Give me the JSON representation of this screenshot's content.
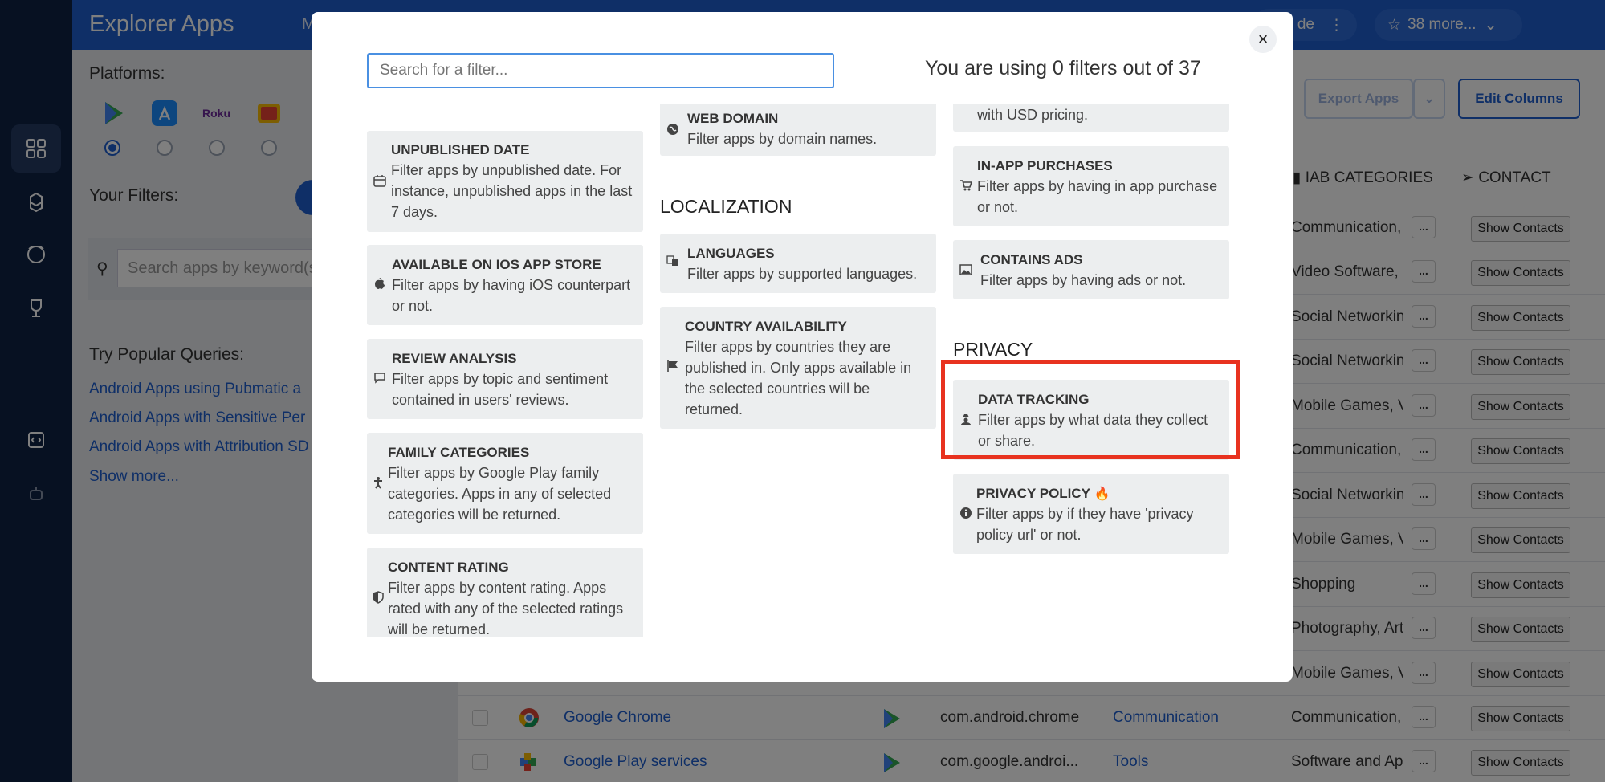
{
  "app_title": "Explorer Apps",
  "top_nav_partial": "M",
  "top_pills": {
    "partial_label": "de",
    "more_label": "38 more..."
  },
  "left_panel": {
    "platforms_label": "Platforms:",
    "roku_label": "Roku",
    "your_filters_label": "Your Filters:",
    "search_placeholder": "Search apps by keyword(s",
    "popular_label": "Try Popular Queries:",
    "queries": [
      "Android Apps using Pubmatic a",
      "Android Apps with Sensitive Per",
      "Android Apps with Attribution SD"
    ],
    "show_more": "Show more..."
  },
  "toolbar": {
    "export_label": "Export Apps",
    "edit_columns_label": "Edit Columns"
  },
  "table": {
    "headers": {
      "iab": "IAB CATEGORIES",
      "contact": "CONTACT"
    },
    "dots_label": "...",
    "contact_button": "Show Contacts",
    "iab_values": [
      "Communication, S",
      "Video Software, S",
      "Social Networking",
      "Social Networking",
      "Mobile Games, Vi",
      "Communication, S",
      "Social Networking",
      "Mobile Games, Vi",
      "Shopping",
      "Photography, Arts",
      "Mobile Games, Vi",
      "Communication, E",
      "Software and App"
    ],
    "bottom_rows": [
      {
        "name": "Google Chrome",
        "package": "com.android.chrome",
        "category": "Communication"
      },
      {
        "name": "Google Play services",
        "package": "com.google.androi...",
        "category": "Tools"
      }
    ]
  },
  "modal": {
    "search_placeholder": "Search for a filter...",
    "usage_text": "You are using 0 filters out of 37",
    "close_label": "×",
    "col1": [
      {
        "title": "UNPUBLISHED DATE",
        "desc": "Filter apps by unpublished date. For instance, unpublished apps in the last 7 days."
      },
      {
        "title": "AVAILABLE ON IOS APP STORE",
        "desc": "Filter apps by having iOS counterpart or not."
      },
      {
        "title": "REVIEW ANALYSIS",
        "desc": "Filter apps by topic and sentiment contained in users' reviews."
      },
      {
        "title": "FAMILY CATEGORIES",
        "desc": "Filter apps by Google Play family categories. Apps in any of selected categories will be returned."
      },
      {
        "title": "CONTENT RATING",
        "desc": "Filter apps by content rating. Apps rated with any of the selected ratings will be returned."
      }
    ],
    "col2": {
      "web_domain": {
        "title": "WEB DOMAIN",
        "desc": "Filter apps by domain names."
      },
      "localization_heading": "LOCALIZATION",
      "languages": {
        "title": "LANGUAGES",
        "desc": "Filter apps by supported languages."
      },
      "country": {
        "title": "COUNTRY AVAILABILITY",
        "desc": "Filter apps by countries they are published in. Only apps available in the selected countries will be returned."
      }
    },
    "col3": {
      "usd_partial": "with USD pricing.",
      "in_app": {
        "title": "IN-APP PURCHASES",
        "desc": "Filter apps by having in app purchase or not."
      },
      "ads": {
        "title": "CONTAINS ADS",
        "desc": "Filter apps by having ads or not."
      },
      "privacy_heading": "PRIVACY",
      "data_tracking": {
        "title": "DATA TRACKING",
        "desc": "Filter apps by what data they collect or share."
      },
      "privacy_policy": {
        "title": "PRIVACY POLICY",
        "desc": "Filter apps by if they have 'privacy policy url' or not."
      }
    }
  },
  "colors": {
    "brand_blue": "#1f5fcf",
    "rail": "#0f2245",
    "highlight": "#e8321f",
    "card": "#eceeef"
  }
}
